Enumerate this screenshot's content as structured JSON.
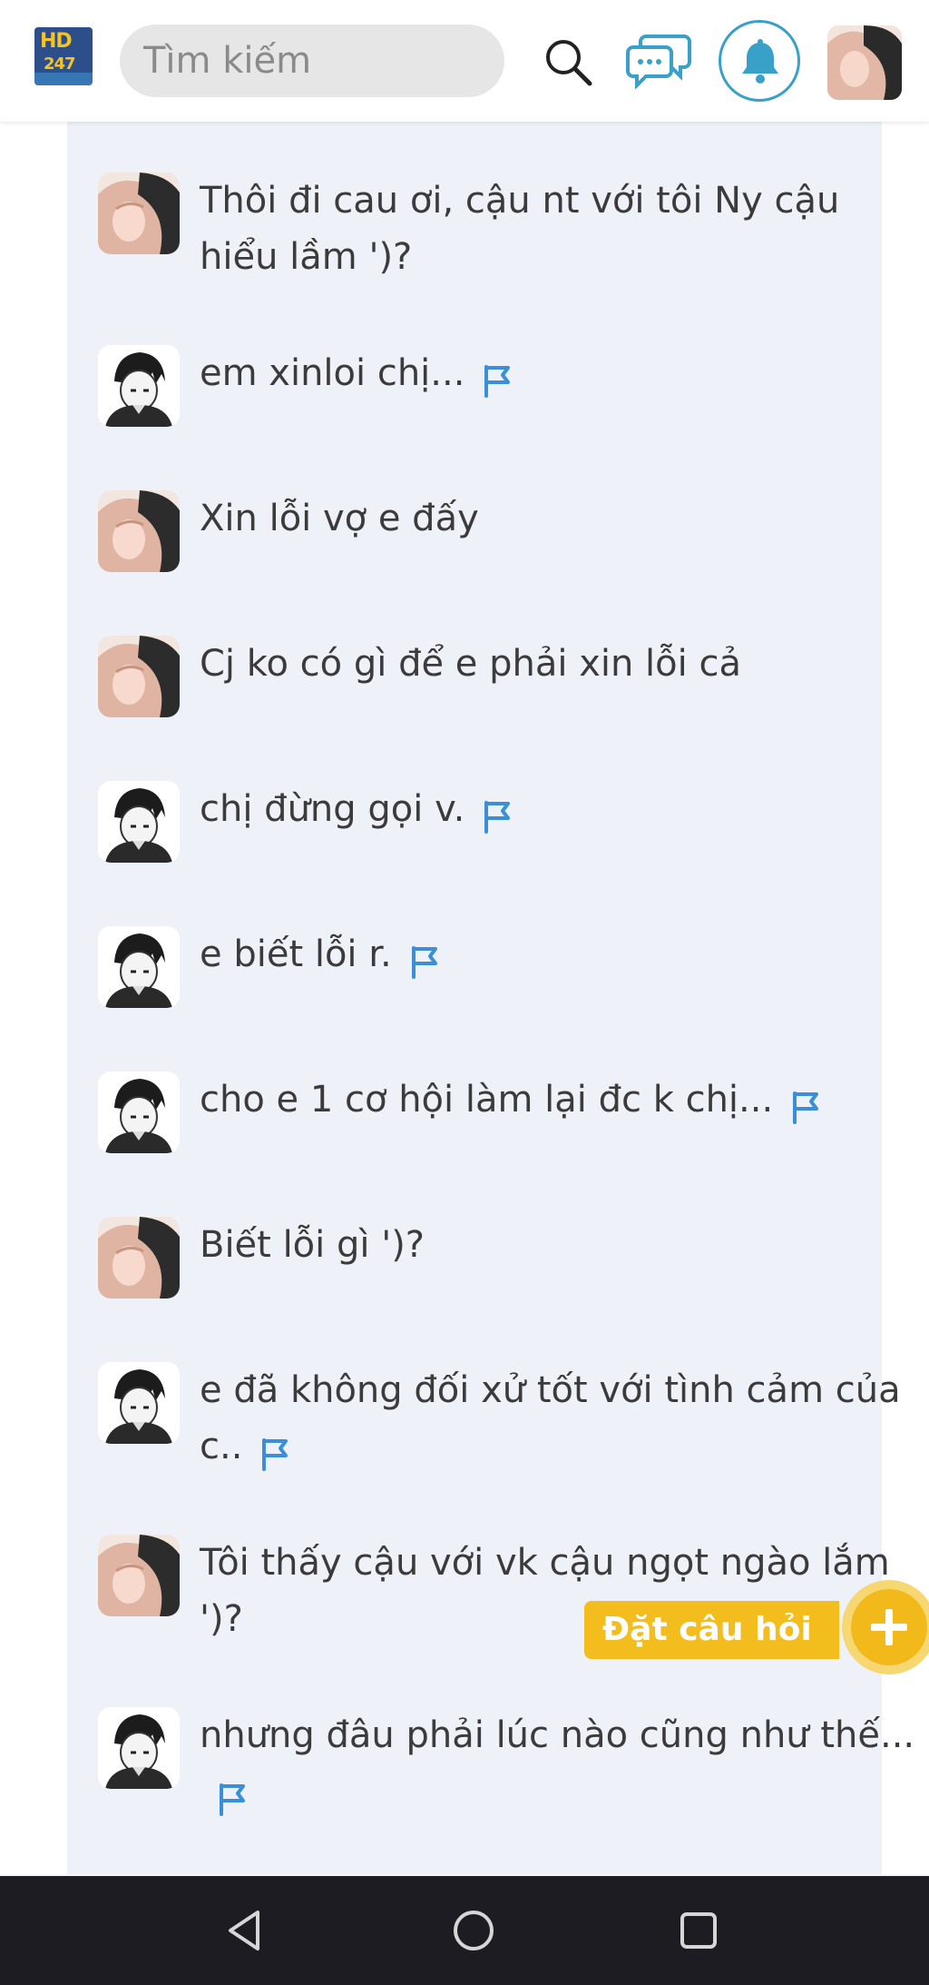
{
  "header": {
    "logo_text_top": "HD",
    "logo_text_bottom": "247",
    "search_placeholder": "Tìm kiếm",
    "accent_color": "#39a0c8",
    "icons": [
      "search-icon",
      "chat-icon",
      "bell-icon",
      "user-avatar"
    ]
  },
  "messages": [
    {
      "avatar": "girl-avatar",
      "text": "Thôi đi cau ơi, cậu nt với tôi Ny cậu hiểu lầm ')?",
      "flag": false
    },
    {
      "avatar": "boy-avatar",
      "text": "em xinloi chị...",
      "flag": true
    },
    {
      "avatar": "girl-avatar",
      "text": "Xin lỗi vợ e đấy",
      "flag": false
    },
    {
      "avatar": "girl-avatar",
      "text": "Cj ko có gì để e phải xin lỗi cả",
      "flag": false
    },
    {
      "avatar": "boy-avatar",
      "text": "chị đừng gọi v.",
      "flag": true
    },
    {
      "avatar": "boy-avatar",
      "text": "e biết lỗi r.",
      "flag": true
    },
    {
      "avatar": "boy-avatar",
      "text": "cho e 1 cơ hội làm lại đc k chị...",
      "flag": true
    },
    {
      "avatar": "girl-avatar",
      "text": "Biết lỗi gì ')?",
      "flag": false
    },
    {
      "avatar": "boy-avatar",
      "text": "e đã không đối xử tốt với tình cảm của c..",
      "flag": true
    },
    {
      "avatar": "girl-avatar",
      "text": "Tôi thấy cậu với vk cậu ngọt ngào lắm ')?",
      "flag": false
    },
    {
      "avatar": "boy-avatar",
      "text": "nhưng đâu phải lúc nào cũng như thế...",
      "flag": true
    }
  ],
  "ask_button": {
    "label": "Đặt câu hỏi",
    "color": "#f2bd1d"
  },
  "navbar": {
    "icons": [
      "back-icon",
      "home-icon",
      "recents-icon"
    ]
  }
}
